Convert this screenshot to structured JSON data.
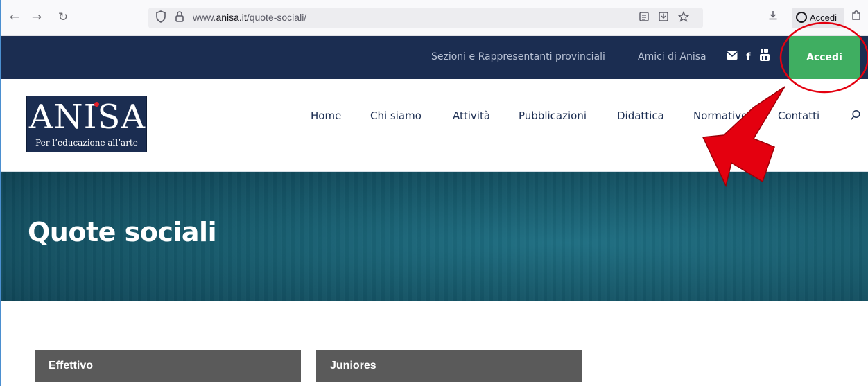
{
  "browser": {
    "back_glyph": "←",
    "forward_glyph": "→",
    "reload_glyph": "↻",
    "url_prefix": "www.",
    "url_host": "anisa.it",
    "url_path": "/quote-sociali/",
    "account_label": "Accedi"
  },
  "site": {
    "top_links": [
      "Sezioni e Rappresentanti provinciali",
      "Amici di Anisa"
    ],
    "social_facebook": "f",
    "accedi_label": "Accedi",
    "logo_word": "ANISA",
    "logo_tagline": "Per l’educazione all’arte",
    "menu": [
      "Home",
      "Chi siamo",
      "Attività",
      "Pubblicazioni",
      "Didattica",
      "Normative",
      "Contatti"
    ]
  },
  "hero": {
    "title": "Quote sociali"
  },
  "cards": [
    "Effettivo",
    "Juniores"
  ],
  "colors": {
    "navy": "#1b2d51",
    "green": "#3fae61",
    "teal": "#175a6c",
    "card_header": "#5a5a5a",
    "annotation_red": "#e4000f"
  },
  "icons": {
    "shield": "shield-icon",
    "lock": "lock-icon",
    "reader": "reader-view-icon",
    "pocket": "save-to-pocket-icon",
    "star": "bookmark-star-icon",
    "download": "download-icon",
    "account": "account-icon",
    "extensions": "extensions-icon",
    "mail": "mail-icon",
    "facebook": "facebook-icon",
    "youtube": "youtube-icon",
    "search": "search-icon"
  }
}
